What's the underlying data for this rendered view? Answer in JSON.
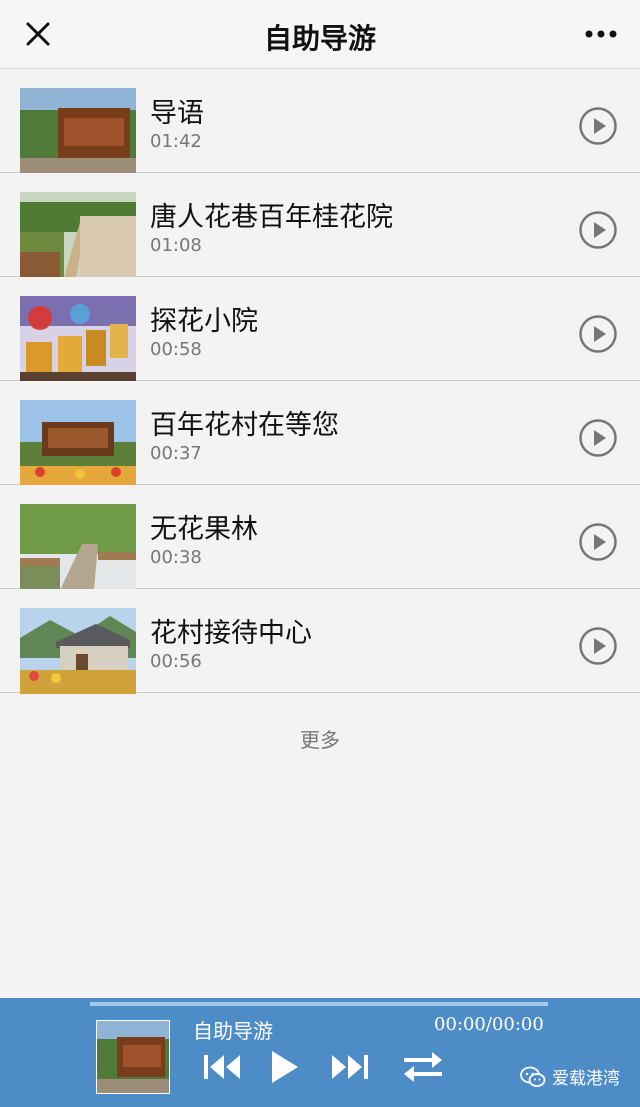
{
  "header": {
    "title": "自助导游",
    "close_icon": "close-icon",
    "more_icon": "more-horizontal-icon"
  },
  "items": [
    {
      "title": "导语",
      "duration": "01:42"
    },
    {
      "title": "唐人花巷百年桂花院",
      "duration": "01:08"
    },
    {
      "title": "探花小院",
      "duration": "00:58"
    },
    {
      "title": "百年花村在等您",
      "duration": "00:37"
    },
    {
      "title": "无花果林",
      "duration": "00:38"
    },
    {
      "title": "花村接待中心",
      "duration": "00:56"
    }
  ],
  "more_label": "更多",
  "player": {
    "title": "自助导游",
    "time": "00:00/00:00",
    "progress": 0,
    "controls": [
      "previous-icon",
      "play-icon",
      "next-icon",
      "loop-icon"
    ]
  },
  "watermark": {
    "text": "爱载港湾",
    "icon": "wechat-icon"
  },
  "colors": {
    "accent": "#4d8cc7",
    "background": "#f3f3f3",
    "divider": "#cfcfcf"
  }
}
